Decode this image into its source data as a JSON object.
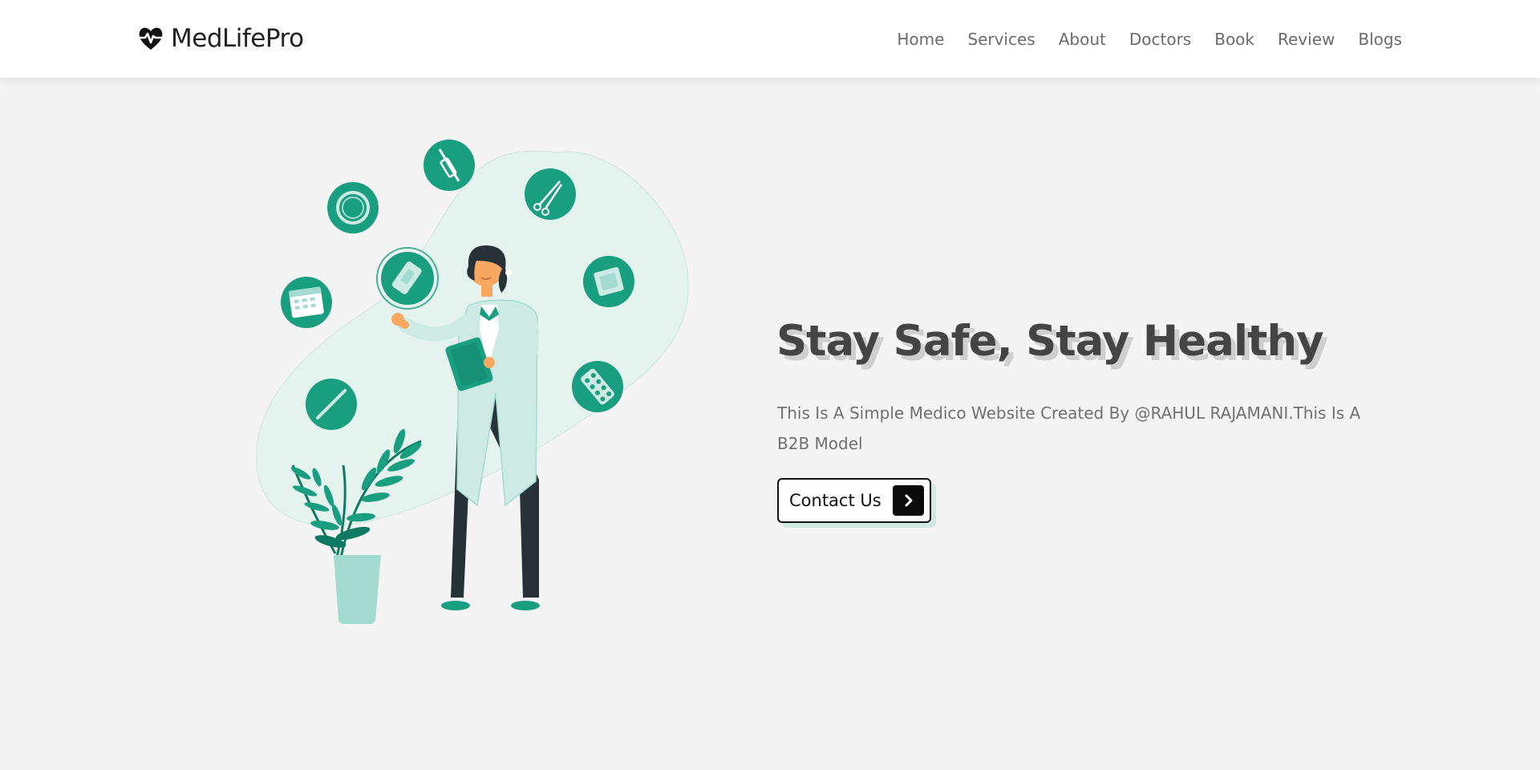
{
  "brand": {
    "name": "MedLifePro",
    "logo_icon": "heartbeat-icon"
  },
  "nav": {
    "items": [
      "Home",
      "Services",
      "About",
      "Doctors",
      "Book",
      "Review",
      "Blogs"
    ]
  },
  "hero": {
    "title": "Stay Safe, Stay Healthy",
    "description": "This Is A Simple Medico Website Created By @RAHUL RAJAMANI.This Is A B2B Model",
    "cta_label": "Contact Us",
    "cta_icon": "chevron-right-icon",
    "illustration_icons": [
      "syringe-icon",
      "scissors-icon",
      "ring-icon",
      "bandage-icon",
      "gauze-icon",
      "calendar-icon",
      "pills-icon",
      "thermometer-icon"
    ]
  },
  "colors": {
    "accent": "#1a9e80",
    "accent_dark": "#0f7a62",
    "blob": "#e5f3ef",
    "page_bg": "#f4f4f4",
    "title": "#444444",
    "nav_text": "#6b6b6b"
  }
}
